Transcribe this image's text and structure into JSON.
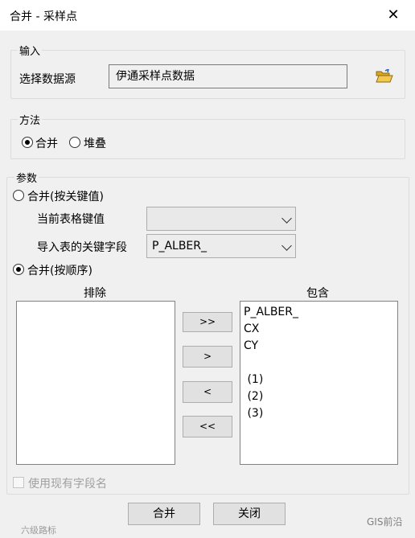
{
  "window": {
    "title": "合并 - 采样点",
    "close_glyph": "✕"
  },
  "input_group": {
    "label": "输入",
    "source_label": "选择数据源",
    "source_value": "伊通采样点数据",
    "browse_icon": "open-folder-icon"
  },
  "method_group": {
    "label": "方法",
    "options": [
      {
        "label": "合并",
        "selected": true
      },
      {
        "label": "堆叠",
        "selected": false
      }
    ]
  },
  "params_group": {
    "label": "参数",
    "by_key": {
      "label": "合并(按关键值)",
      "selected": false,
      "current_key_label": "当前表格键值",
      "current_key_value": "",
      "import_key_label": "导入表的关键字段",
      "import_key_value": "P_ALBER_"
    },
    "by_order": {
      "label": "合并(按顺序)",
      "selected": true
    },
    "exclude": {
      "header": "排除",
      "items": []
    },
    "include": {
      "header": "包含",
      "items": [
        "P_ALBER_",
        "CX",
        "CY",
        "",
        " (1)",
        " (2)",
        " (3)"
      ]
    },
    "move_buttons": {
      "add_all": ">>",
      "add": ">",
      "remove": "<",
      "remove_all": "<<"
    },
    "use_existing_names": {
      "label": "使用现有字段名",
      "checked": false,
      "enabled": false
    }
  },
  "footer": {
    "merge_button": "合并",
    "close_button": "关闭"
  },
  "watermarks": {
    "left": "六级路标",
    "right": "GIS前沿"
  }
}
